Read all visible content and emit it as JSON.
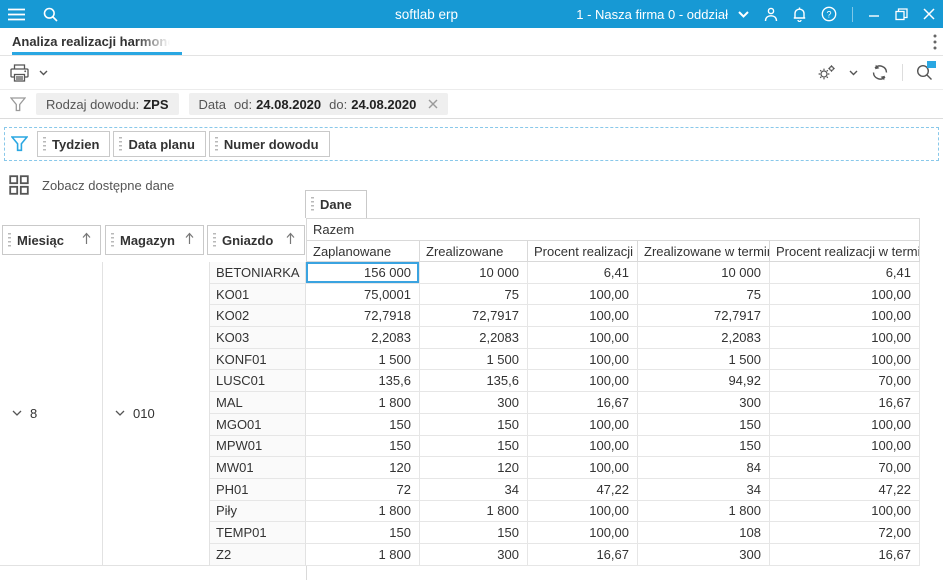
{
  "topbar": {
    "title": "softlab erp",
    "company": "1 - Nasza firma 0 - oddział"
  },
  "tabbar": {
    "active_tab": "Analiza realizacji harmonogramu"
  },
  "filters": {
    "document_type": {
      "label": "Rodzaj dowodu:",
      "value": "ZPS"
    },
    "date": {
      "label": "Data",
      "od_label": "od:",
      "od_value": "24.08.2020",
      "do_label": "do:",
      "do_value": "24.08.2020"
    }
  },
  "dropzone_fields": [
    "Tydzien",
    "Data planu",
    "Numer dowodu"
  ],
  "available_data_label": "Zobacz dostępne dane",
  "data_tab_label": "Dane",
  "pivot": {
    "row_fields": [
      "Miesiąc",
      "Magazyn",
      "Gniazdo"
    ],
    "group_header": "Razem",
    "columns": [
      "Zaplanowane",
      "Zrealizowane",
      "Procent realizacji",
      "Zrealizowane w terminie",
      "Procent realizacji w terminie"
    ],
    "month_group": "8",
    "warehouse_group": "010",
    "rows": [
      {
        "gniazdo": "BETONIARKA",
        "values": [
          "156 000",
          "10 000",
          "6,41",
          "10 000",
          "6,41"
        ],
        "selected_col": 0
      },
      {
        "gniazdo": "KO01",
        "values": [
          "75,0001",
          "75",
          "100,00",
          "75",
          "100,00"
        ]
      },
      {
        "gniazdo": "KO02",
        "values": [
          "72,7918",
          "72,7917",
          "100,00",
          "72,7917",
          "100,00"
        ]
      },
      {
        "gniazdo": "KO03",
        "values": [
          "2,2083",
          "2,2083",
          "100,00",
          "2,2083",
          "100,00"
        ]
      },
      {
        "gniazdo": "KONF01",
        "values": [
          "1 500",
          "1 500",
          "100,00",
          "1 500",
          "100,00"
        ]
      },
      {
        "gniazdo": "LUSC01",
        "values": [
          "135,6",
          "135,6",
          "100,00",
          "94,92",
          "70,00"
        ]
      },
      {
        "gniazdo": "MAL",
        "values": [
          "1 800",
          "300",
          "16,67",
          "300",
          "16,67"
        ]
      },
      {
        "gniazdo": "MGO01",
        "values": [
          "150",
          "150",
          "100,00",
          "150",
          "100,00"
        ]
      },
      {
        "gniazdo": "MPW01",
        "values": [
          "150",
          "150",
          "100,00",
          "150",
          "100,00"
        ]
      },
      {
        "gniazdo": "MW01",
        "values": [
          "120",
          "120",
          "100,00",
          "84",
          "70,00"
        ]
      },
      {
        "gniazdo": "PH01",
        "values": [
          "72",
          "34",
          "47,22",
          "34",
          "47,22"
        ]
      },
      {
        "gniazdo": "Piły",
        "values": [
          "1 800",
          "1 800",
          "100,00",
          "1 800",
          "100,00"
        ]
      },
      {
        "gniazdo": "TEMP01",
        "values": [
          "150",
          "150",
          "100,00",
          "108",
          "72,00"
        ]
      },
      {
        "gniazdo": "Z2",
        "values": [
          "1 800",
          "300",
          "16,67",
          "300",
          "16,67"
        ]
      }
    ]
  },
  "icons": [
    "menu-icon",
    "search-icon",
    "chevron-down-icon",
    "user-icon",
    "bell-icon",
    "help-icon",
    "minimize-icon",
    "restore-icon",
    "close-icon",
    "kebab-icon",
    "printer-icon",
    "gear-icon",
    "refresh-icon",
    "filter-icon",
    "grid-icon",
    "sort-asc-icon"
  ],
  "colors": {
    "topbar": "#1799d4",
    "accent": "#2aa7e2",
    "selection": "#3aa3e0"
  }
}
